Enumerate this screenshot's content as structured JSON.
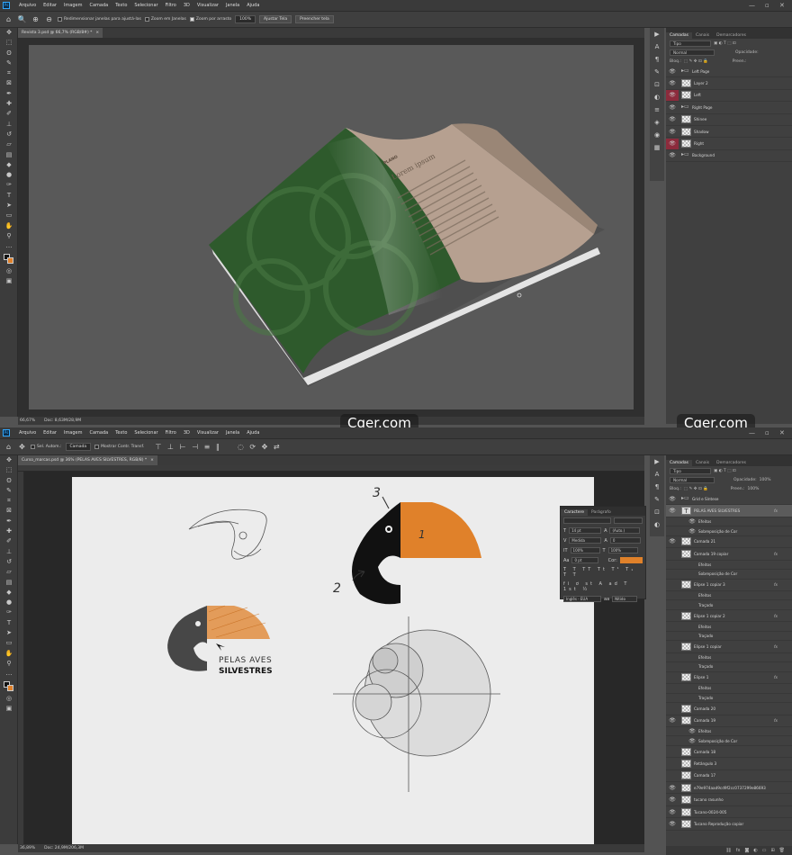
{
  "menu": [
    "Arquivo",
    "Editar",
    "Imagem",
    "Camada",
    "Texto",
    "Selecionar",
    "Filtro",
    "3D",
    "Visualizar",
    "Janela",
    "Ajuda"
  ],
  "ps_logo": "Ps",
  "window_controls": [
    "—",
    "▫",
    "✕"
  ],
  "top": {
    "options": {
      "resize_windows": "Redimensionar janelas para ajustá-las",
      "zoom_all": "Zoom em Janelas",
      "scrubby_zoom": "Zoom por arrasto",
      "zoom_value": "100%",
      "fit_screen": "Ajustar Tela",
      "fill_screen": "Preencher tela"
    },
    "tab": "Revista 3.psd @ 66,7% (RGB/8#) *",
    "status": {
      "zoom": "66,67%",
      "doc": "Doc: 8,63M/28,9M"
    },
    "panel_tabs": [
      "Camadas",
      "Canais",
      "Demarcadores"
    ],
    "kind": "Tipo",
    "blend": "Normal",
    "opacity_label": "Opacidade:",
    "lock_label": "Bloq.:",
    "fill_label": "Preen.:",
    "layers": [
      {
        "name": "Left Page",
        "kind": "folder",
        "eye": "on"
      },
      {
        "name": "Layer 2",
        "kind": "normal",
        "eye": "on"
      },
      {
        "name": "Left",
        "kind": "normal",
        "eye": "red"
      },
      {
        "name": "Right Page",
        "kind": "folder",
        "eye": "on"
      },
      {
        "name": "Shinee",
        "kind": "normal",
        "eye": "on"
      },
      {
        "name": "Shadow",
        "kind": "normal",
        "eye": "on"
      },
      {
        "name": "Right",
        "kind": "normal",
        "eye": "red"
      },
      {
        "name": "Background",
        "kind": "folder",
        "eye": "on"
      }
    ],
    "magazine": {
      "title": "Lorem ipsum",
      "logo": "PLANO"
    }
  },
  "bottom": {
    "options": {
      "auto_select": "Sel. Autom.:",
      "auto_select_target": "Camada",
      "show_transform": "Mostrar Contr. Transf."
    },
    "tab": "Curso_marcas.psd @ 36% (PELAS AVES SILVESTRES, RGB/8) *",
    "status": {
      "zoom": "36,89%",
      "doc": "Doc: 24,9M/206,3M"
    },
    "panel_tabs": [
      "Camadas",
      "Canais",
      "Demarcadores"
    ],
    "kind": "Tipo",
    "blend": "Normal",
    "opacity_label": "Opacidade:",
    "opacity_value": "100%",
    "lock_label": "Bloq.:",
    "fill_label": "Preen.:",
    "fill_value": "100%",
    "layers": [
      {
        "name": "Grid e Síntese",
        "kind": "folder",
        "eye": "on",
        "fx": false,
        "sub": false
      },
      {
        "name": "PELAS AVES SILVESTRES",
        "kind": "text",
        "eye": "on",
        "fx": true,
        "sub": false,
        "selected": true
      },
      {
        "name": "Efeitos",
        "kind": "effect",
        "eye": "on",
        "fx": false,
        "sub": true
      },
      {
        "name": "Sobreposição de Cor",
        "kind": "effect",
        "eye": "on",
        "fx": false,
        "sub": true
      },
      {
        "name": "Camada 21",
        "kind": "normal",
        "eye": "on",
        "fx": false,
        "sub": false
      },
      {
        "name": "Camada 19 copiar",
        "kind": "normal",
        "eye": "off",
        "fx": true,
        "sub": false
      },
      {
        "name": "Efeitos",
        "kind": "effect",
        "eye": "off",
        "fx": false,
        "sub": true
      },
      {
        "name": "Sobreposição de Cor",
        "kind": "effect",
        "eye": "off",
        "fx": false,
        "sub": true
      },
      {
        "name": "Elipse 1 copiar 3",
        "kind": "shape",
        "eye": "off",
        "fx": true,
        "sub": false
      },
      {
        "name": "Efeitos",
        "kind": "effect",
        "eye": "off",
        "fx": false,
        "sub": true
      },
      {
        "name": "Traçado",
        "kind": "effect",
        "eye": "off",
        "fx": false,
        "sub": true
      },
      {
        "name": "Elipse 1 copiar 2",
        "kind": "shape",
        "eye": "off",
        "fx": true,
        "sub": false
      },
      {
        "name": "Efeitos",
        "kind": "effect",
        "eye": "off",
        "fx": false,
        "sub": true
      },
      {
        "name": "Traçado",
        "kind": "effect",
        "eye": "off",
        "fx": false,
        "sub": true
      },
      {
        "name": "Elipse 1 copiar",
        "kind": "shape",
        "eye": "off",
        "fx": true,
        "sub": false
      },
      {
        "name": "Efeitos",
        "kind": "effect",
        "eye": "off",
        "fx": false,
        "sub": true
      },
      {
        "name": "Traçado",
        "kind": "effect",
        "eye": "off",
        "fx": false,
        "sub": true
      },
      {
        "name": "Elipse 1",
        "kind": "shape",
        "eye": "off",
        "fx": true,
        "sub": false
      },
      {
        "name": "Efeitos",
        "kind": "effect",
        "eye": "off",
        "fx": false,
        "sub": true
      },
      {
        "name": "Traçado",
        "kind": "effect",
        "eye": "off",
        "fx": false,
        "sub": true
      },
      {
        "name": "Camada 20",
        "kind": "normal",
        "eye": "off",
        "fx": false,
        "sub": false
      },
      {
        "name": "Camada 19",
        "kind": "normal",
        "eye": "on",
        "fx": true,
        "sub": false
      },
      {
        "name": "Efeitos",
        "kind": "effect",
        "eye": "on",
        "fx": false,
        "sub": true
      },
      {
        "name": "Sobreposição de Cor",
        "kind": "effect",
        "eye": "on",
        "fx": false,
        "sub": true
      },
      {
        "name": "Camada 18",
        "kind": "normal",
        "eye": "off",
        "fx": false,
        "sub": false
      },
      {
        "name": "Retângulo 3",
        "kind": "shape",
        "eye": "off",
        "fx": false,
        "sub": false
      },
      {
        "name": "Camada 17",
        "kind": "normal",
        "eye": "off",
        "fx": false,
        "sub": false
      },
      {
        "name": "e79e974aad9cd9f2cc0737299e86693",
        "kind": "normal",
        "eye": "on",
        "fx": false,
        "sub": false
      },
      {
        "name": "tucano rasunho",
        "kind": "normal",
        "eye": "on",
        "fx": false,
        "sub": false
      },
      {
        "name": "Tucano-0024-005",
        "kind": "normal",
        "eye": "on",
        "fx": false,
        "sub": false
      },
      {
        "name": "Tucano Reprodução copiar",
        "kind": "normal",
        "eye": "on",
        "fx": false,
        "sub": false
      }
    ],
    "character_panel": {
      "tabs": [
        "Caractere",
        "Parágrafo"
      ],
      "size": "14 pt",
      "leading": "(Auto.)",
      "kerning": "Medida",
      "tracking": "0",
      "vscale": "100%",
      "hscale": "100%",
      "baseline": "0 pt",
      "color_label": "Cor:",
      "language": "Inglês - EUA",
      "aa": "Nítido"
    },
    "artwork": {
      "brand_line1": "PELAS AVES",
      "brand_line2": "SILVESTRES",
      "note_1": "1",
      "note_2": "2",
      "note_3": "3"
    }
  },
  "watermark": "Cger.com",
  "colors": {
    "accent_orange": "#e0812a",
    "forest_green": "#2e5a2c",
    "page_beige": "#b6a090",
    "visibility_red": "#8c2b3c"
  }
}
